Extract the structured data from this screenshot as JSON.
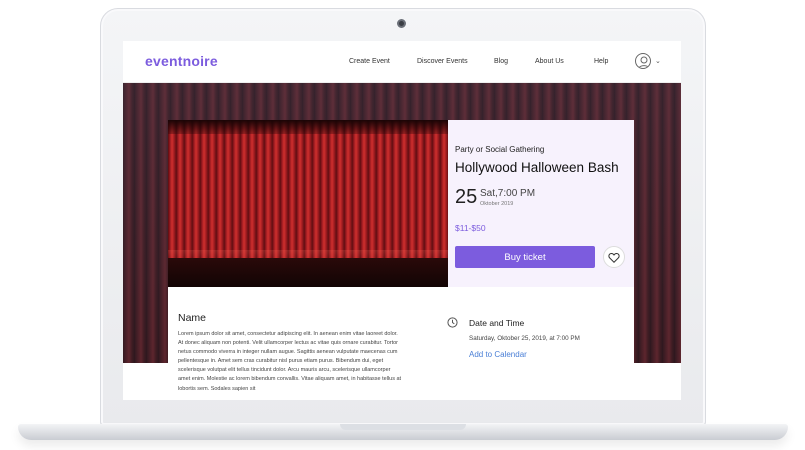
{
  "brand": {
    "logo": "eventnoire",
    "accent": "#7c5cde"
  },
  "nav": {
    "links": [
      "Create Event",
      "Discover Events",
      "Blog",
      "About Us",
      "Help"
    ],
    "avatar_icon": "user-icon",
    "dropdown_icon": "chevron-down-icon"
  },
  "event": {
    "category": "Party or Social Gathering",
    "title": "Hollywood Halloween Bash",
    "day": "25",
    "weekday_time": "Sat,7:00 PM",
    "month_year": "Oktober 2019",
    "price": "$11-$50",
    "buy_label": "Buy ticket",
    "favorite_icon": "heart-icon"
  },
  "details": {
    "name_heading": "Name",
    "description": "Lorem ipsum dolor sit amet, consectetur adipiscing elit. In aenean enim vitae laoreet dolor. At donec aliquam non potenti. Velit ullamcorper lectus ac vitae quis ornare curabitur. Tortor netus commodo viverra in integer nullam augue. Sagittis aenean vulputate maecenas cum pellentesque in. Amet sem cras curabitur nisl purus etiam purus. Bibendum dui, eget scelerisque volutpat elit tellus tincidunt dolor. Arcu mauris arcu, scelerisque ullamcorper amet enim. Molestie ac lorem bibendum convallis. Vitae aliquam amet, in habitasse tellus at lobortis sem. Sodales sapien sit",
    "date_time_heading": "Date and Time",
    "date_time_value": "Saturday, Oktober 25, 2019, at 7:00 PM",
    "add_to_calendar": "Add to Calendar",
    "clock_icon": "clock-icon"
  }
}
